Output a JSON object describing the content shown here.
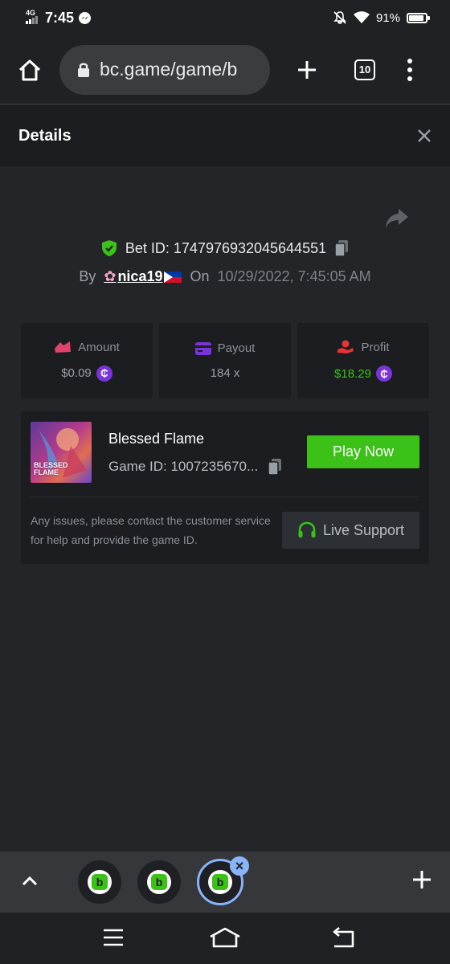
{
  "status": {
    "network": "4G",
    "time": "7:45",
    "battery": "91%",
    "battery_level": 0.91
  },
  "browser": {
    "url": "bc.game/game/b",
    "tab_count": "10"
  },
  "details": {
    "title": "Details"
  },
  "bet": {
    "id_label": "Bet ID: 1747976932045644551",
    "by_label": "By",
    "username": "nica19",
    "on_label": "On",
    "date": "10/29/2022, 7:45:05 AM"
  },
  "stats": [
    {
      "label": "Amount",
      "value": "$0.09",
      "icon": "amount-icon",
      "color": "#e0446b"
    },
    {
      "label": "Payout",
      "value": "184 x",
      "icon": "payout-icon",
      "color": "#7a35d8"
    },
    {
      "label": "Profit",
      "value": "$18.29",
      "icon": "profit-icon",
      "color": "#e53535"
    }
  ],
  "coin_symbol": "₵",
  "game": {
    "name": "Blessed Flame",
    "id_label": "Game ID: 1007235670...",
    "thumb_text_1": "BLESSED",
    "thumb_text_2": "FLAME",
    "play_label": "Play Now"
  },
  "support": {
    "text": "Any issues, please contact the customer service for help and provide the game ID.",
    "button_label": "Live Support"
  },
  "colors": {
    "accent_green": "#3bc117",
    "background": "#232529",
    "card": "#1b1d20",
    "active_tab": "#8ab4f8"
  },
  "tab_strip": {
    "logo_letter": "b"
  }
}
